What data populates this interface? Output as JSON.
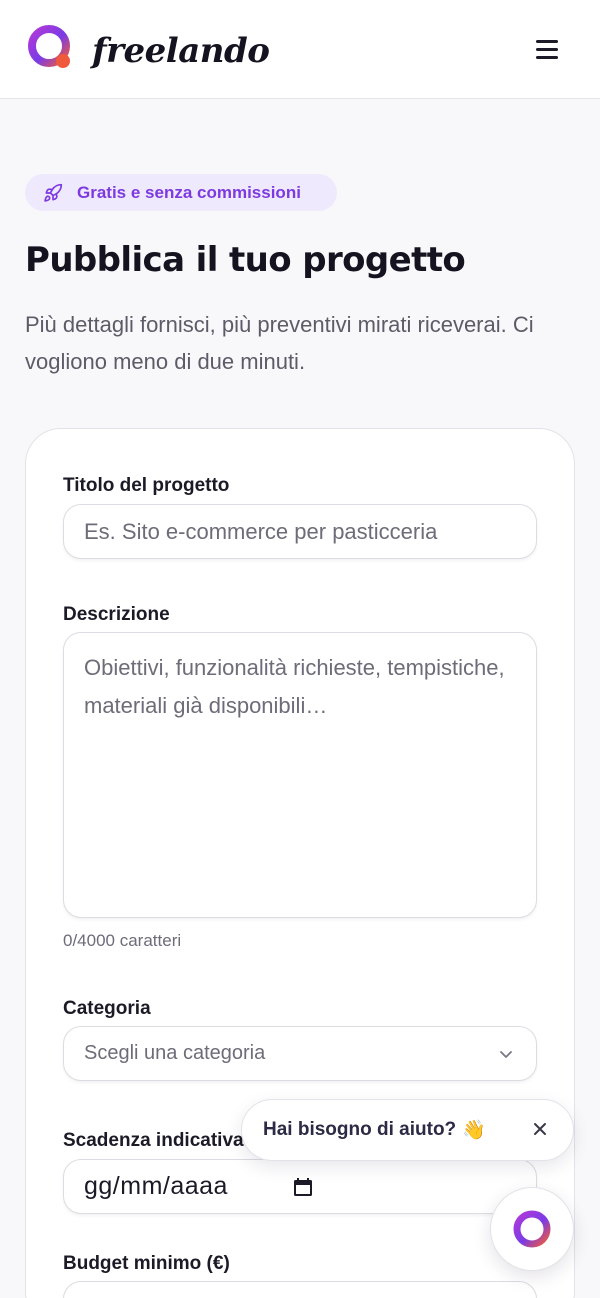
{
  "brand": {
    "name": "freelando",
    "colors": {
      "primary": "#7c3ae0",
      "accent": "#f05a3c"
    }
  },
  "header": {
    "menu_icon": "hamburger-menu-icon"
  },
  "intro": {
    "badge": {
      "icon": "rocket-icon",
      "label": "Gratis e senza commissioni"
    },
    "title": "Pubblica il tuo progetto",
    "subtitle": "Più dettagli fornisci, più preventivi mirati riceverai. Ci vogliono meno di due minuti."
  },
  "form": {
    "title": {
      "label": "Titolo del progetto",
      "placeholder": "Es. Sito e-commerce per pasticceria"
    },
    "description": {
      "label": "Descrizione",
      "placeholder": "Obiettivi, funzionalità richieste, tempistiche, materiali già disponibili…",
      "counter": "0/4000 caratteri"
    },
    "category": {
      "label": "Categoria",
      "selected": "Scegli una categoria",
      "icon": "chevron-down-icon"
    },
    "deadline": {
      "label": "Scadenza indicativa",
      "value": "gg/mm/aaaa",
      "icon": "calendar-icon"
    },
    "budget_min": {
      "label": "Budget minimo (€)"
    }
  },
  "help_widget": {
    "text": "Hai bisogno di aiuto?",
    "emoji": "👋",
    "close_icon": "close-icon",
    "launcher_icon": "freelando-logo-icon"
  }
}
